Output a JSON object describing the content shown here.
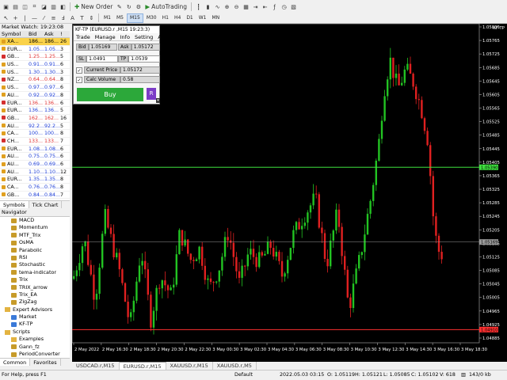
{
  "toolbar": {
    "new_order": "New Order",
    "autotrading": "AutoTrading",
    "timeframes": [
      "M1",
      "M5",
      "M15",
      "M30",
      "H1",
      "H4",
      "D1",
      "W1",
      "MN"
    ],
    "active_timeframe": "M15"
  },
  "market_watch": {
    "title": "Market Watch: 19:23:08",
    "headers": [
      "Symbol",
      "Bid",
      "Ask",
      "!"
    ],
    "rows": [
      {
        "sym": "XA...",
        "bid": "186...",
        "ask": "186...",
        "spr": "26",
        "dir": "up",
        "selected": true
      },
      {
        "sym": "EUR...",
        "bid": "1.05...",
        "ask": "1.05...",
        "spr": "3",
        "dir": "up"
      },
      {
        "sym": "GB...",
        "bid": "1.25...",
        "ask": "1.25...",
        "spr": "5",
        "dir": "down"
      },
      {
        "sym": "US...",
        "bid": "0.91...",
        "ask": "0.91...",
        "spr": "6",
        "dir": "up"
      },
      {
        "sym": "US...",
        "bid": "1.30...",
        "ask": "1.30...",
        "spr": "3",
        "dir": "up"
      },
      {
        "sym": "NZ...",
        "bid": "0.64...",
        "ask": "0.64...",
        "spr": "8",
        "dir": "down"
      },
      {
        "sym": "US...",
        "bid": "0.97...",
        "ask": "0.97...",
        "spr": "6",
        "dir": "up"
      },
      {
        "sym": "AU...",
        "bid": "0.92...",
        "ask": "0.92...",
        "spr": "8",
        "dir": "up"
      },
      {
        "sym": "EUR...",
        "bid": "136...",
        "ask": "136...",
        "spr": "6",
        "dir": "down"
      },
      {
        "sym": "EUR...",
        "bid": "136...",
        "ask": "136...",
        "spr": "5",
        "dir": "up"
      },
      {
        "sym": "GB...",
        "bid": "162...",
        "ask": "162...",
        "spr": "16",
        "dir": "down"
      },
      {
        "sym": "AU...",
        "bid": "92.2...",
        "ask": "92.2...",
        "spr": "5",
        "dir": "up"
      },
      {
        "sym": "CA...",
        "bid": "100...",
        "ask": "100...",
        "spr": "8",
        "dir": "up"
      },
      {
        "sym": "CH...",
        "bid": "133...",
        "ask": "133...",
        "spr": "7",
        "dir": "down"
      },
      {
        "sym": "EUR...",
        "bid": "1.08...",
        "ask": "1.08...",
        "spr": "6",
        "dir": "up"
      },
      {
        "sym": "AU...",
        "bid": "0.75...",
        "ask": "0.75...",
        "spr": "6",
        "dir": "up"
      },
      {
        "sym": "AU...",
        "bid": "0.69...",
        "ask": "0.69...",
        "spr": "6",
        "dir": "up"
      },
      {
        "sym": "AU...",
        "bid": "1.10...",
        "ask": "1.10...",
        "spr": "12",
        "dir": "up"
      },
      {
        "sym": "EUR...",
        "bid": "1.35...",
        "ask": "1.35...",
        "spr": "8",
        "dir": "up"
      },
      {
        "sym": "CA...",
        "bid": "0.76...",
        "ask": "0.76...",
        "spr": "8",
        "dir": "up"
      },
      {
        "sym": "GB...",
        "bid": "0.84...",
        "ask": "0.84...",
        "spr": "7",
        "dir": "up"
      }
    ],
    "tabs": [
      "Symbols",
      "Tick Chart"
    ]
  },
  "navigator": {
    "title": "Navigator",
    "items": [
      {
        "label": "MACD",
        "indent": 2,
        "kind": "ind"
      },
      {
        "label": "Momentum",
        "indent": 2,
        "kind": "ind"
      },
      {
        "label": "MTF_Trix",
        "indent": 2,
        "kind": "ind"
      },
      {
        "label": "OsMA",
        "indent": 2,
        "kind": "ind"
      },
      {
        "label": "Parabolic",
        "indent": 2,
        "kind": "ind"
      },
      {
        "label": "RSI",
        "indent": 2,
        "kind": "ind"
      },
      {
        "label": "Stochastic",
        "indent": 2,
        "kind": "ind"
      },
      {
        "label": "tema-indicator",
        "indent": 2,
        "kind": "ind"
      },
      {
        "label": "Trix",
        "indent": 2,
        "kind": "ind"
      },
      {
        "label": "TRIX_arrow",
        "indent": 2,
        "kind": "ind"
      },
      {
        "label": "Trix_EA",
        "indent": 2,
        "kind": "ind"
      },
      {
        "label": "ZigZag",
        "indent": 2,
        "kind": "ind"
      },
      {
        "label": "Expert Advisors",
        "indent": 1,
        "kind": "folder"
      },
      {
        "label": "Market",
        "indent": 2,
        "kind": "ea"
      },
      {
        "label": "KF-TP",
        "indent": 2,
        "kind": "ea"
      },
      {
        "label": "Scripts",
        "indent": 1,
        "kind": "folder"
      },
      {
        "label": "Examples",
        "indent": 2,
        "kind": "folder"
      },
      {
        "label": "Gann_fz",
        "indent": 2,
        "kind": "script"
      },
      {
        "label": "PeriodConverter",
        "indent": 2,
        "kind": "script"
      }
    ],
    "tabs": [
      "Common",
      "Favorites"
    ]
  },
  "kf_panel": {
    "title": "KF-TP (EURUSD.r ,M15  19:23:3)",
    "menu": [
      "Trade",
      "Manage",
      "Info",
      "Setting",
      "About"
    ],
    "bid_label": "Bid",
    "bid": "1.05169",
    "ask_label": "Ask",
    "ask": "1.05172",
    "sl_label": "SL",
    "sl": "1.0491",
    "tp_label": "TP",
    "tp": "1.0539",
    "current_price_label": "Current Price",
    "current_price": "1.05172",
    "calc_volume_label": "Calc Volume",
    "calc_volume": "0.58",
    "buy": "Buy",
    "r": "R"
  },
  "chart": {
    "title": "KF-TP",
    "price_labels": [
      "1.05805",
      "1.05765",
      "1.05725",
      "1.05685",
      "1.05645",
      "1.05605",
      "1.05565",
      "1.05525",
      "1.05485",
      "1.05445",
      "1.05405",
      "1.05365",
      "1.05325",
      "1.05285",
      "1.05245",
      "1.05205",
      "1.05165",
      "1.05125",
      "1.05085",
      "1.05045",
      "1.05005",
      "1.04965",
      "1.04925",
      "1.04885"
    ],
    "time_labels": [
      "2 May 2022",
      "2 May 16:30",
      "2 May 18:30",
      "2 May 20:30",
      "2 May 22:30",
      "3 May 00:30",
      "3 May 02:30",
      "3 May 04:30",
      "3 May 06:30",
      "3 May 08:30",
      "3 May 10:30",
      "3 May 12:30",
      "3 May 14:30",
      "3 May 16:30",
      "3 May 18:30"
    ],
    "tp_line": "1.05390",
    "current_line": "1.05169",
    "sl_line": "1.04910",
    "colors": {
      "bull": "#22c322",
      "bear": "#e02020",
      "tp": "#3ee03e",
      "sl": "#ff3030",
      "current": "#9a9a9a"
    }
  },
  "chart_tabs": [
    "USDCAD.r,M15",
    "EURUSD.r,M15",
    "XAUUSD.r,M15",
    "XAUUSD.r,M5"
  ],
  "status": {
    "help": "For Help, press F1",
    "profile": "Default",
    "time": "2022.05.03 03:15",
    "o": "O: 1.05119",
    "h": "H: 1.05121",
    "l": "L: 1.05085",
    "c": "C: 1.05102",
    "v": "V: 618",
    "traffic": "143/0 kb"
  }
}
